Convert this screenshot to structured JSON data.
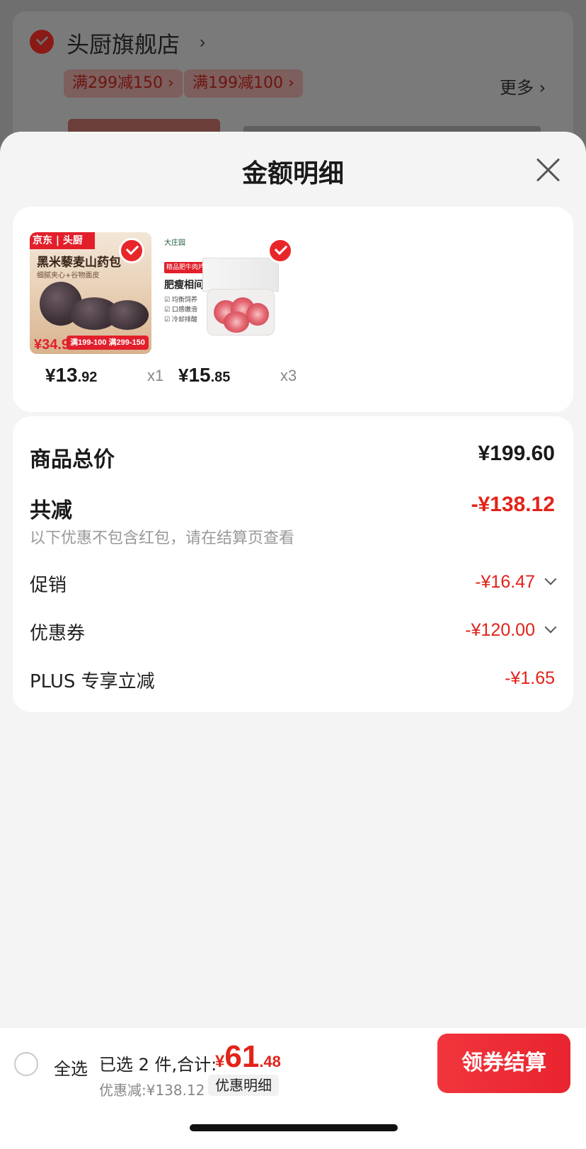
{
  "background": {
    "store_name": "头厨旗舰店",
    "coupon_tags": [
      "满299减150 ›",
      "满199减100 ›"
    ],
    "more_label": "更多 ›"
  },
  "sheet": {
    "title": "金额明细"
  },
  "products": [
    {
      "image_brand": "京东 | 头厨",
      "image_title": "黑米藜麦山药包",
      "image_subtitle": "细腻夹心+谷物面皮",
      "image_price": "¥34.9",
      "image_promo": "满199-100 满299-150",
      "price_yen": "¥",
      "price_int": "13",
      "price_dec": ".92",
      "qty": "x1",
      "selected": true
    },
    {
      "image_brand": "大庄园",
      "image_tag": "精品肥牛肉片",
      "image_title": "肥瘦相间",
      "image_features": [
        "☑ 均衡饲养",
        "☑ 口感嫩滑",
        "☑ 冷却排酸"
      ],
      "price_yen": "¥",
      "price_int": "15",
      "price_dec": ".85",
      "qty": "x3",
      "selected": true
    }
  ],
  "summary": {
    "total_label": "商品总价",
    "total_value": "¥199.60",
    "discount_label": "共减",
    "discount_value": "-¥138.12",
    "note": "以下优惠不包含红包，请在结算页查看",
    "promo_label": "促销",
    "promo_value": "-¥16.47",
    "coupon_label": "优惠券",
    "coupon_value": "-¥120.00",
    "plus_label": "PLUS 专享立减",
    "plus_value": "-¥1.65"
  },
  "bottom": {
    "select_all": "全选",
    "selected_text": "已选 2 件,合计:",
    "total_yen": "¥",
    "total_int": "61",
    "total_dec": ".48",
    "saved": "优惠减:¥138.12",
    "detail_button": "优惠明细",
    "checkout_button": "领券结算"
  },
  "colors": {
    "accent_red": "#e2231a",
    "checkout_red": "#f2353c"
  }
}
